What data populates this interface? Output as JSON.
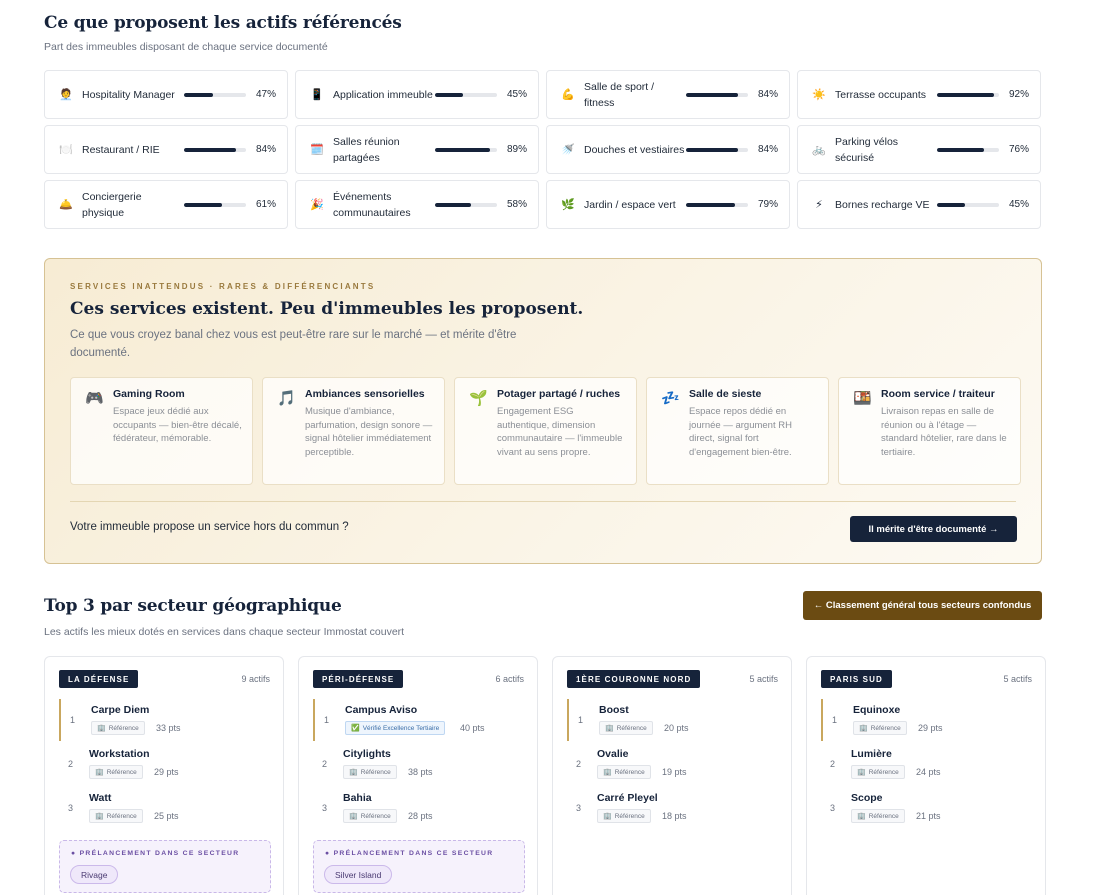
{
  "offer": {
    "title": "Ce que proposent les actifs référencés",
    "subtitle": "Part des immeubles disposant de chaque service documenté",
    "services": [
      {
        "name": "Hospitality Manager",
        "pct": "47%",
        "value": 47,
        "icon": "🧑‍💼",
        "icon_name": "concierge-person-icon"
      },
      {
        "name": "Application immeuble",
        "pct": "45%",
        "value": 45,
        "icon": "📱",
        "icon_name": "phone-app-icon"
      },
      {
        "name": "Salle de sport / fitness",
        "pct": "84%",
        "value": 84,
        "icon": "💪",
        "icon_name": "flexed-arm-icon"
      },
      {
        "name": "Terrasse occupants",
        "pct": "92%",
        "value": 92,
        "icon": "☀️",
        "icon_name": "sun-icon"
      },
      {
        "name": "Restaurant / RIE",
        "pct": "84%",
        "value": 84,
        "icon": "🍽️",
        "icon_name": "plate-icon"
      },
      {
        "name": "Salles réunion partagées",
        "pct": "89%",
        "value": 89,
        "icon": "🗓️",
        "icon_name": "calendar-icon"
      },
      {
        "name": "Douches et vestiaires",
        "pct": "84%",
        "value": 84,
        "icon": "🚿",
        "icon_name": "shower-icon"
      },
      {
        "name": "Parking vélos sécurisé",
        "pct": "76%",
        "value": 76,
        "icon": "🚲",
        "icon_name": "bicycle-icon"
      },
      {
        "name": "Conciergerie physique",
        "pct": "61%",
        "value": 61,
        "icon": "🛎️",
        "icon_name": "bell-icon"
      },
      {
        "name": "Événements communautaires",
        "pct": "58%",
        "value": 58,
        "icon": "🎉",
        "icon_name": "party-icon"
      },
      {
        "name": "Jardin / espace vert",
        "pct": "79%",
        "value": 79,
        "icon": "🌿",
        "icon_name": "leaf-icon"
      },
      {
        "name": "Bornes recharge VE",
        "pct": "45%",
        "value": 45,
        "icon": "⚡",
        "icon_name": "lightning-icon"
      }
    ]
  },
  "rare": {
    "eyebrow": "SERVICES INATTENDUS · RARES & DIFFÉRENCIANTS",
    "title": "Ces services existent. Peu d'immeubles les proposent.",
    "description": "Ce que vous croyez banal chez vous est peut-être rare sur le marché — et mérite d'être documenté.",
    "items": [
      {
        "title": "Gaming Room",
        "desc": "Espace jeux dédié aux occupants — bien-être décalé, fédérateur, mémorable.",
        "icon": "🎮",
        "icon_name": "gamepad-icon"
      },
      {
        "title": "Ambiances sensorielles",
        "desc": "Musique d'ambiance, parfumation, design sonore — signal hôtelier immédiatement perceptible.",
        "icon": "🎵",
        "icon_name": "music-note-icon"
      },
      {
        "title": "Potager partagé / ruches",
        "desc": "Engagement ESG authentique, dimension communautaire — l'immeuble vivant au sens propre.",
        "icon": "🌱",
        "icon_name": "seedling-icon"
      },
      {
        "title": "Salle de sieste",
        "desc": "Espace repos dédié en journée — argument RH direct, signal fort d'engagement bien-être.",
        "icon": "💤",
        "icon_name": "sleep-icon"
      },
      {
        "title": "Room service / traiteur",
        "desc": "Livraison repas en salle de réunion ou à l'étage — standard hôtelier, rare dans le tertiaire.",
        "icon": "🍱",
        "icon_name": "bento-icon"
      }
    ],
    "cta_question": "Votre immeuble propose un service hors du commun ?",
    "cta_button": "Il mérite d'être documenté →"
  },
  "top3": {
    "title": "Top 3 par secteur géographique",
    "subtitle": "Les actifs les mieux dotés en services dans chaque secteur Immostat couvert",
    "ranking_button": "← Classement général tous secteurs confondus",
    "sectors": [
      {
        "name": "LA DÉFENSE",
        "count": "9 actifs",
        "entries": [
          {
            "rank": "1",
            "name": "Carpe Diem",
            "tag": "Référence",
            "pts": "33 pts"
          },
          {
            "rank": "2",
            "name": "Workstation",
            "tag": "Référence",
            "pts": "29 pts"
          },
          {
            "rank": "3",
            "name": "Watt",
            "tag": "Référence",
            "pts": "25 pts"
          }
        ],
        "prelaunch_label": "PRÉLANCEMENT DANS CE SECTEUR",
        "prelaunch_chip": "Rivage"
      },
      {
        "name": "PÉRI-DÉFENSE",
        "count": "6 actifs",
        "entries": [
          {
            "rank": "1",
            "name": "Campus Aviso",
            "tag": "Vérifié Excellence Tertiaire",
            "pts": "40 pts"
          },
          {
            "rank": "2",
            "name": "Citylights",
            "tag": "Référence",
            "pts": "38 pts"
          },
          {
            "rank": "3",
            "name": "Bahia",
            "tag": "Référence",
            "pts": "28 pts"
          }
        ],
        "prelaunch_label": "PRÉLANCEMENT DANS CE SECTEUR",
        "prelaunch_chip": "Silver Island"
      },
      {
        "name": "1ÈRE COURONNE NORD",
        "count": "5 actifs",
        "entries": [
          {
            "rank": "1",
            "name": "Boost",
            "tag": "Référence",
            "pts": "20 pts"
          },
          {
            "rank": "2",
            "name": "Ovalie",
            "tag": "Référence",
            "pts": "19 pts"
          },
          {
            "rank": "3",
            "name": "Carré Pleyel",
            "tag": "Référence",
            "pts": "18 pts"
          }
        ]
      },
      {
        "name": "PARIS SUD",
        "count": "5 actifs",
        "entries": [
          {
            "rank": "1",
            "name": "Equinoxe",
            "tag": "Référence",
            "pts": "29 pts"
          },
          {
            "rank": "2",
            "name": "Lumière",
            "tag": "Référence",
            "pts": "24 pts"
          },
          {
            "rank": "3",
            "name": "Scope",
            "tag": "Référence",
            "pts": "21 pts"
          }
        ]
      }
    ]
  },
  "colors": {
    "navy": "#16233a",
    "gold": "#c9a75e",
    "brown": "#6b4b12"
  }
}
